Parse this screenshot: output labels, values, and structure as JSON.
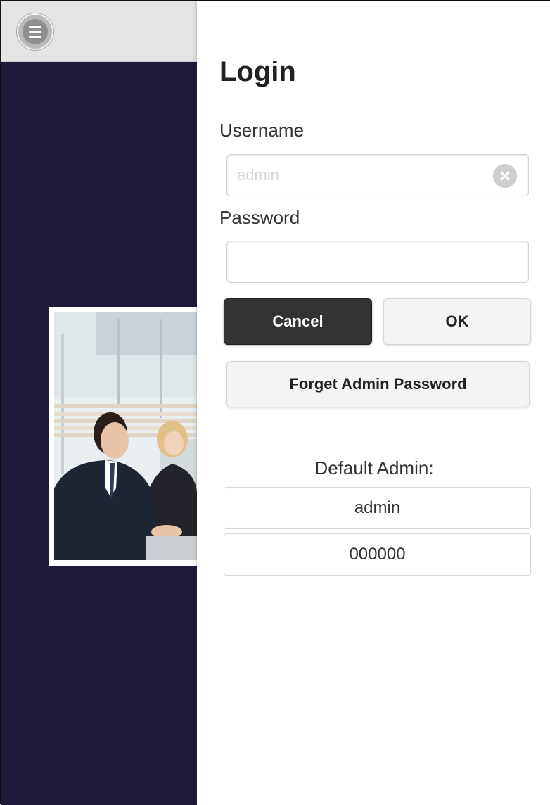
{
  "login": {
    "title": "Login",
    "username_label": "Username",
    "username_placeholder": "admin",
    "password_label": "Password",
    "password_value": "",
    "cancel_label": "Cancel",
    "ok_label": "OK",
    "forget_label": "Forget Admin Password"
  },
  "default_admin": {
    "label": "Default Admin:",
    "username": "admin",
    "password": "000000"
  },
  "icons": {
    "menu": "menu-icon",
    "clear": "clear-icon"
  },
  "colors": {
    "background": "#1e1a3a",
    "header": "#e4e4e4",
    "cancel_button": "#333333",
    "panel": "#ffffff"
  }
}
